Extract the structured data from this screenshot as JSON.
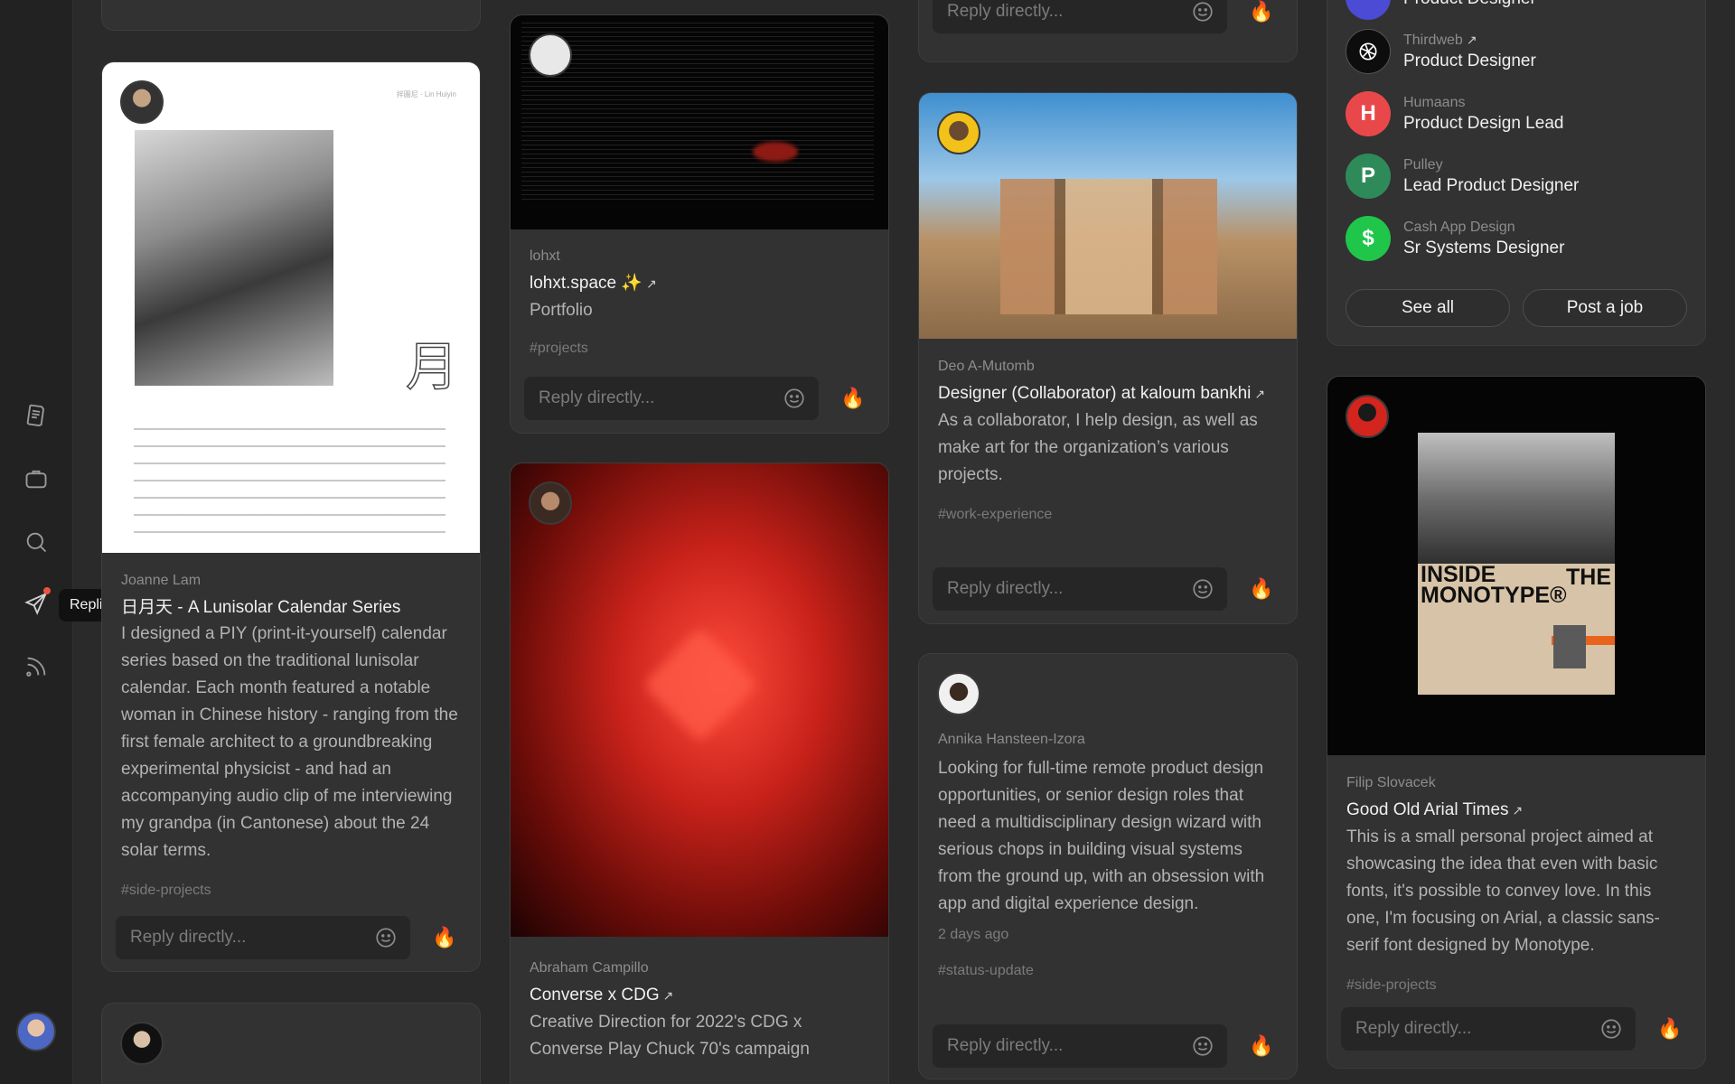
{
  "sidebar": {
    "items": [
      {
        "name": "notes",
        "icon": "notes-icon"
      },
      {
        "name": "jobs",
        "icon": "briefcase-icon"
      },
      {
        "name": "search",
        "icon": "search-icon"
      },
      {
        "name": "replies",
        "icon": "send-icon"
      },
      {
        "name": "feed",
        "icon": "rss-icon"
      }
    ],
    "tooltip": "Replies"
  },
  "reply": {
    "placeholder": "Reply directly...",
    "fire": "🔥"
  },
  "posts": {
    "joanne": {
      "author": "Joanne Lam",
      "title": "日月天 - A Lunisolar Calendar Series",
      "description": "I designed a PIY (print-it-yourself) calendar series based on the traditional lunisolar calendar. Each month featured a notable woman in Chinese history - ranging from the first female architect to a groundbreaking experimental physicist - and had an accompanying audio clip of me interviewing my grandpa (in Cantonese) about the 24 solar terms.",
      "tag": "#side-projects",
      "calendar_glyph": "月",
      "calendar_header": "拌圖尼 · Lin Huiyin"
    },
    "lohxt": {
      "author": "lohxt",
      "title": "lohxt.space ✨",
      "subtitle": "Portfolio",
      "tag": "#projects"
    },
    "abraham": {
      "author": "Abraham Campillo",
      "title": "Converse x CDG",
      "description": "Creative Direction for 2022's CDG x Converse Play Chuck 70's campaign"
    },
    "deo": {
      "author": "Deo A-Mutomb",
      "title": "Designer (Collaborator) at kaloum bankhi",
      "description": "As a collaborator, I help design, as well as make art for the organization’s various projects.",
      "tag": "#work-experience"
    },
    "annika": {
      "author": "Annika Hansteen-Izora",
      "description": "Looking for full-time remote product design opportunities, or senior design roles that need a multidisciplinary design wizard with serious chops in building visual systems from the ground up, with an obsession with app and digital experience design.",
      "time": "2 days ago",
      "tag": "#status-update"
    },
    "filip": {
      "author": "Filip Slovacek",
      "title": "Good Old Arial Times",
      "description": "This is a small personal project aimed at showcasing the idea that even with basic fonts, it's possible to convey love. In this one, I'm focusing on Arial, a classic sans-serif font designed by Monotype.",
      "tag": "#side-projects",
      "poster_title": "INSIDE MONOTYPE®",
      "poster_the": "THE"
    }
  },
  "jobs": {
    "items": [
      {
        "company": "",
        "role": "Product Designer",
        "logo": "",
        "color": "#4b4bd6"
      },
      {
        "company": "Thirdweb",
        "role": "Product Designer",
        "logo": "",
        "color": "#0d0d0d"
      },
      {
        "company": "Humaans",
        "role": "Product Design Lead",
        "logo": "H",
        "color": "#e9484b"
      },
      {
        "company": "Pulley",
        "role": "Lead Product Designer",
        "logo": "P",
        "color": "#2f8a5a"
      },
      {
        "company": "Cash App Design",
        "role": "Sr Systems Designer",
        "logo": "$",
        "color": "#1fc64a"
      }
    ],
    "see_all": "See all",
    "post_job": "Post a job"
  }
}
